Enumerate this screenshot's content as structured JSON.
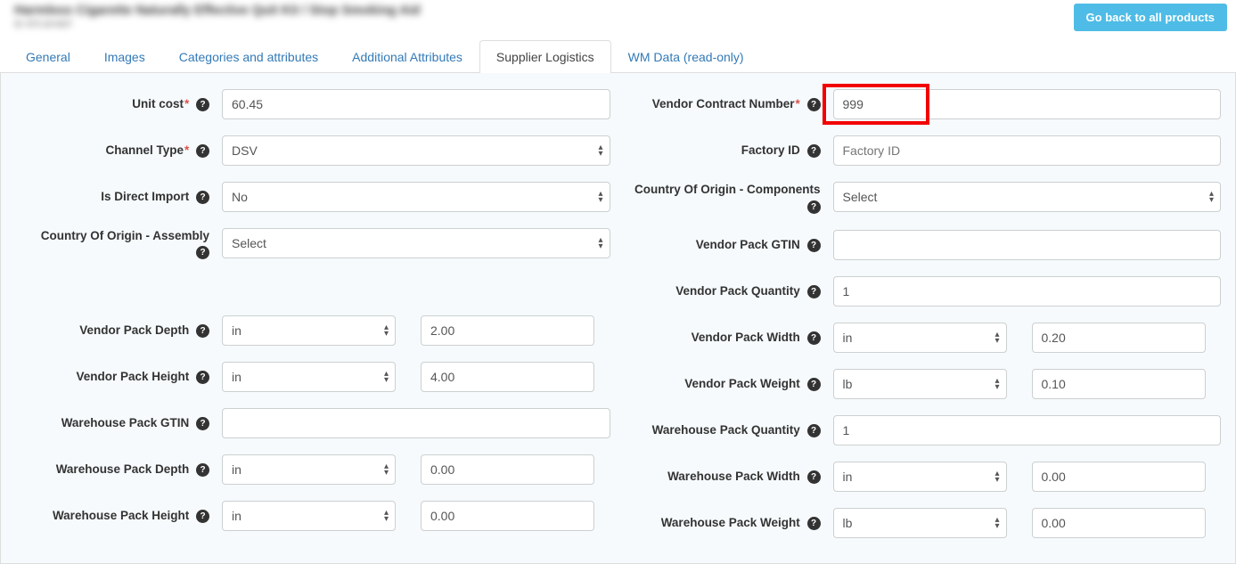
{
  "header": {
    "blurred_title": "Harmless Cigarette Naturally Effective Quit Kit / Stop Smoking Aid",
    "blurred_sub": "ID: 873-18-0637",
    "back_button": "Go back to all products"
  },
  "tabs": {
    "general": "General",
    "images": "Images",
    "categories": "Categories and attributes",
    "additional": "Additional Attributes",
    "supplier": "Supplier Logistics",
    "wmdata": "WM Data (read-only)"
  },
  "labels": {
    "unit_cost": "Unit cost",
    "channel_type": "Channel Type",
    "is_direct_import": "Is Direct Import",
    "coo_assembly": "Country Of Origin - Assembly",
    "vendor_contract_number": "Vendor Contract Number",
    "factory_id": "Factory ID",
    "coo_components": "Country Of Origin - Components",
    "vendor_pack_gtin": "Vendor Pack GTIN",
    "vendor_pack_qty": "Vendor Pack Quantity",
    "vendor_pack_depth": "Vendor Pack Depth",
    "vendor_pack_width": "Vendor Pack Width",
    "vendor_pack_height": "Vendor Pack Height",
    "vendor_pack_weight": "Vendor Pack Weight",
    "warehouse_pack_gtin": "Warehouse Pack GTIN",
    "warehouse_pack_qty": "Warehouse Pack Quantity",
    "warehouse_pack_depth": "Warehouse Pack Depth",
    "warehouse_pack_width": "Warehouse Pack Width",
    "warehouse_pack_height": "Warehouse Pack Height",
    "warehouse_pack_weight": "Warehouse Pack Weight"
  },
  "values": {
    "unit_cost": "60.45",
    "channel_type": "DSV",
    "is_direct_import": "No",
    "coo_assembly": "Select",
    "vendor_contract_number": "999",
    "factory_id": "",
    "factory_id_placeholder": "Factory ID",
    "coo_components": "Select",
    "vendor_pack_gtin": "",
    "vendor_pack_qty": "1",
    "vendor_pack_depth_unit": "in",
    "vendor_pack_depth_val": "2.00",
    "vendor_pack_width_unit": "in",
    "vendor_pack_width_val": "0.20",
    "vendor_pack_height_unit": "in",
    "vendor_pack_height_val": "4.00",
    "vendor_pack_weight_unit": "lb",
    "vendor_pack_weight_val": "0.10",
    "warehouse_pack_gtin": "",
    "warehouse_pack_qty": "1",
    "warehouse_pack_depth_unit": "in",
    "warehouse_pack_depth_val": "0.00",
    "warehouse_pack_width_unit": "in",
    "warehouse_pack_width_val": "0.00",
    "warehouse_pack_height_unit": "in",
    "warehouse_pack_height_val": "0.00",
    "warehouse_pack_weight_unit": "lb",
    "warehouse_pack_weight_val": "0.00"
  }
}
